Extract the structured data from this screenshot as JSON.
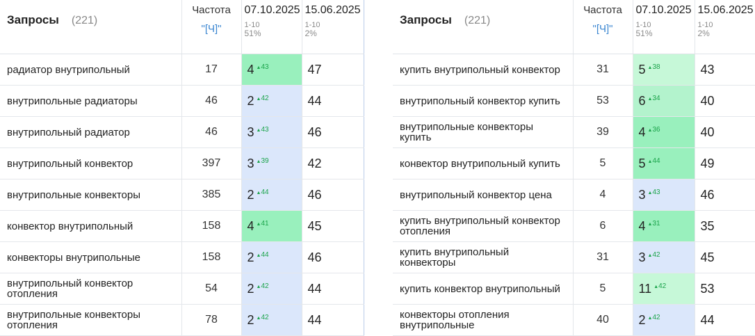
{
  "left": {
    "header": {
      "title": "Запросы",
      "count": "(221)",
      "freq_label": "Частота",
      "freq_link": "\"[Ч]\"",
      "date1": "07.10.2025",
      "date1_range": "1-10",
      "date1_pct": "51%",
      "date2": "15.06.2025",
      "date2_range": "1-10",
      "date2_pct": "2%"
    },
    "rows": [
      {
        "query": "радиатор внутрипольный",
        "freq": "17",
        "pos": "4",
        "delta": "43",
        "old": "47",
        "color": "green"
      },
      {
        "query": "внутрипольные радиаторы",
        "freq": "46",
        "pos": "2",
        "delta": "42",
        "old": "44",
        "color": "blue"
      },
      {
        "query": "внутрипольный радиатор",
        "freq": "46",
        "pos": "3",
        "delta": "43",
        "old": "46",
        "color": "blue"
      },
      {
        "query": "внутрипольный конвектор",
        "freq": "397",
        "pos": "3",
        "delta": "39",
        "old": "42",
        "color": "blue"
      },
      {
        "query": "внутрипольные конвекторы",
        "freq": "385",
        "pos": "2",
        "delta": "44",
        "old": "46",
        "color": "blue"
      },
      {
        "query": "конвектор внутрипольный",
        "freq": "158",
        "pos": "4",
        "delta": "41",
        "old": "45",
        "color": "green"
      },
      {
        "query": "конвекторы внутрипольные",
        "freq": "158",
        "pos": "2",
        "delta": "44",
        "old": "46",
        "color": "blue"
      },
      {
        "query": "внутрипольный конвектор отопления",
        "freq": "54",
        "pos": "2",
        "delta": "42",
        "old": "44",
        "color": "blue"
      },
      {
        "query": "внутрипольные конвекторы отопления",
        "freq": "78",
        "pos": "2",
        "delta": "42",
        "old": "44",
        "color": "blue"
      }
    ]
  },
  "right": {
    "header": {
      "title": "Запросы",
      "count": "(221)",
      "freq_label": "Частота",
      "freq_link": "\"[Ч]\"",
      "date1": "07.10.2025",
      "date1_range": "1-10",
      "date1_pct": "51%",
      "date2": "15.06.2025",
      "date2_range": "1-10",
      "date2_pct": "2%"
    },
    "rows": [
      {
        "query": "купить внутрипольный конвектор",
        "freq": "31",
        "pos": "5",
        "delta": "38",
        "old": "43",
        "color": "lightgreen"
      },
      {
        "query": "внутрипольный конвектор купить",
        "freq": "53",
        "pos": "6",
        "delta": "34",
        "old": "40",
        "color": "midgreen"
      },
      {
        "query": "внутрипольные конвекторы купить",
        "freq": "39",
        "pos": "4",
        "delta": "36",
        "old": "40",
        "color": "green"
      },
      {
        "query": "конвектор внутрипольный купить",
        "freq": "5",
        "pos": "5",
        "delta": "44",
        "old": "49",
        "color": "green"
      },
      {
        "query": "внутрипольный конвектор цена",
        "freq": "4",
        "pos": "3",
        "delta": "43",
        "old": "46",
        "color": "blue"
      },
      {
        "query": "купить внутрипольный конвектор отопления",
        "freq": "6",
        "pos": "4",
        "delta": "31",
        "old": "35",
        "color": "green"
      },
      {
        "query": "купить внутрипольный конвекторы",
        "freq": "31",
        "pos": "3",
        "delta": "42",
        "old": "45",
        "color": "blue"
      },
      {
        "query": "купить конвектор внутрипольный",
        "freq": "5",
        "pos": "11",
        "delta": "42",
        "old": "53",
        "color": "lightgreen"
      },
      {
        "query": "конвекторы отопления внутрипольные",
        "freq": "40",
        "pos": "2",
        "delta": "42",
        "old": "44",
        "color": "blue"
      }
    ]
  },
  "colors": {
    "blue_cell": "#dbe7fb",
    "green_cell": "#99f0bd",
    "lightgreen_cell": "#c6f8d8",
    "delta_green": "#1aa34a",
    "link_blue": "#3b86d1"
  }
}
